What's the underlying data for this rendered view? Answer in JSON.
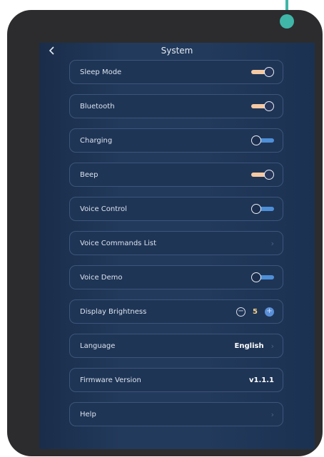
{
  "header": {
    "title": "System"
  },
  "settings": {
    "sleep_mode": {
      "label": "Sleep Mode",
      "on": true
    },
    "bluetooth": {
      "label": "Bluetooth",
      "on": true
    },
    "charging": {
      "label": "Charging",
      "on": false
    },
    "beep": {
      "label": "Beep",
      "on": true
    },
    "voice_control": {
      "label": "Voice Control",
      "on": false
    },
    "voice_commands_list": {
      "label": "Voice Commands List"
    },
    "voice_demo": {
      "label": "Voice Demo",
      "on": false
    },
    "display_brightness": {
      "label": "Display Brightness",
      "value": "5",
      "minus": "−",
      "plus": "+"
    },
    "language": {
      "label": "Language",
      "value": "English"
    },
    "firmware_version": {
      "label": "Firmware Version",
      "value": "v1.1.1"
    },
    "help": {
      "label": "Help"
    }
  },
  "colors": {
    "accent_teal": "#3fb6a8",
    "toggle_on": "#f4c9a4",
    "toggle_off": "#4e8fd8",
    "brightness_value": "#f3d08a"
  },
  "icons": {
    "back": "chevron-left-icon",
    "chevron": "chevron-right-icon"
  }
}
